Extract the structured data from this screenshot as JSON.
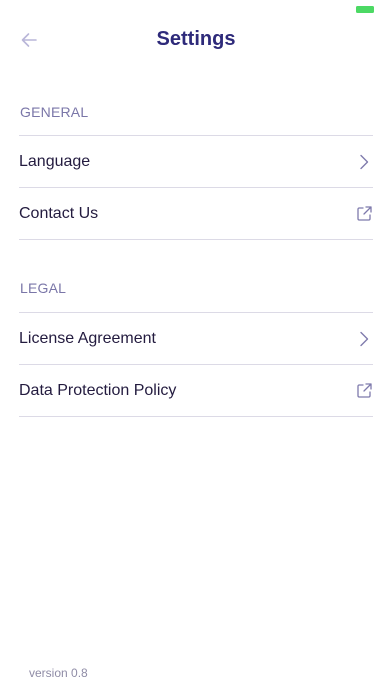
{
  "header": {
    "title": "Settings",
    "back_icon": "arrow-left-icon"
  },
  "sections": [
    {
      "label": "GENERAL",
      "items": [
        {
          "label": "Language",
          "icon": "chevron-right-icon"
        },
        {
          "label": "Contact Us",
          "icon": "external-link-icon"
        }
      ]
    },
    {
      "label": "LEGAL",
      "items": [
        {
          "label": "License Agreement",
          "icon": "chevron-right-icon"
        },
        {
          "label": "Data Protection Policy",
          "icon": "external-link-icon"
        }
      ]
    }
  ],
  "footer": {
    "version": "version 0.8"
  },
  "colors": {
    "title": "#2e2a7a",
    "text": "#231b3f",
    "section_label": "#7a76a8",
    "icon": "#7e7aac",
    "back_icon": "#b9b6d8",
    "divider": "#dcdae6",
    "version": "#8f8ca6",
    "battery": "#4cd964"
  }
}
